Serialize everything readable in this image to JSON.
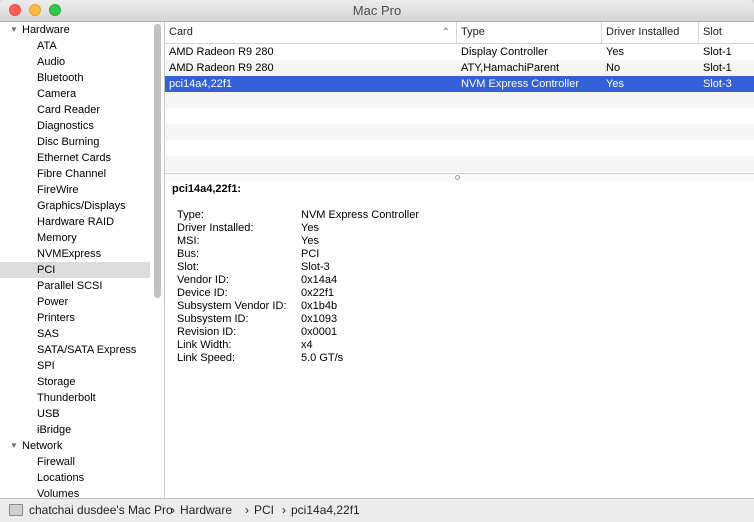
{
  "window": {
    "title": "Mac Pro"
  },
  "sidebar": {
    "items": [
      {
        "label": "Hardware",
        "kind": "header",
        "icon": "disclosure-triangle-down"
      },
      {
        "label": "ATA"
      },
      {
        "label": "Audio"
      },
      {
        "label": "Bluetooth"
      },
      {
        "label": "Camera"
      },
      {
        "label": "Card Reader"
      },
      {
        "label": "Diagnostics"
      },
      {
        "label": "Disc Burning"
      },
      {
        "label": "Ethernet Cards"
      },
      {
        "label": "Fibre Channel"
      },
      {
        "label": "FireWire"
      },
      {
        "label": "Graphics/Displays"
      },
      {
        "label": "Hardware RAID"
      },
      {
        "label": "Memory"
      },
      {
        "label": "NVMExpress"
      },
      {
        "label": "PCI",
        "selected": true
      },
      {
        "label": "Parallel SCSI"
      },
      {
        "label": "Power"
      },
      {
        "label": "Printers"
      },
      {
        "label": "SAS"
      },
      {
        "label": "SATA/SATA Express"
      },
      {
        "label": "SPI"
      },
      {
        "label": "Storage"
      },
      {
        "label": "Thunderbolt"
      },
      {
        "label": "USB"
      },
      {
        "label": "iBridge"
      },
      {
        "label": "Network",
        "kind": "header",
        "icon": "disclosure-triangle-down"
      },
      {
        "label": "Firewall"
      },
      {
        "label": "Locations"
      },
      {
        "label": "Volumes"
      }
    ]
  },
  "table": {
    "columns": [
      "Card",
      "Type",
      "Driver Installed",
      "Slot"
    ],
    "sort_icon": "sort-ascending-chevron",
    "rows": [
      [
        "AMD Radeon R9 280",
        "Display Controller",
        "Yes",
        "Slot-1"
      ],
      [
        "AMD Radeon R9 280",
        "ATY,HamachiParent",
        "No",
        "Slot-1"
      ],
      [
        "pci14a4,22f1",
        "NVM Express Controller",
        "Yes",
        "Slot-3"
      ]
    ],
    "selected_row": 2
  },
  "detail": {
    "title": "pci14a4,22f1:",
    "properties": [
      [
        "Type:",
        "NVM Express Controller"
      ],
      [
        "Driver Installed:",
        "Yes"
      ],
      [
        "MSI:",
        "Yes"
      ],
      [
        "Bus:",
        "PCI"
      ],
      [
        "Slot:",
        "Slot-3"
      ],
      [
        "Vendor ID:",
        "0x14a4"
      ],
      [
        "Device ID:",
        "0x22f1"
      ],
      [
        "Subsystem Vendor ID:",
        "0x1b4b"
      ],
      [
        "Subsystem ID:",
        "0x1093"
      ],
      [
        "Revision ID:",
        "0x0001"
      ],
      [
        "Link Width:",
        "x4"
      ],
      [
        "Link Speed:",
        "5.0 GT/s"
      ]
    ]
  },
  "pathbar": {
    "icon": "mac-pro-icon",
    "crumbs": [
      "chatchai dusdee's Mac Pro",
      "Hardware",
      "PCI",
      "pci14a4,22f1"
    ],
    "separator": "›"
  },
  "colors": {
    "selection": "#3461d8",
    "sidebar_selection": "#dcdcdc"
  }
}
